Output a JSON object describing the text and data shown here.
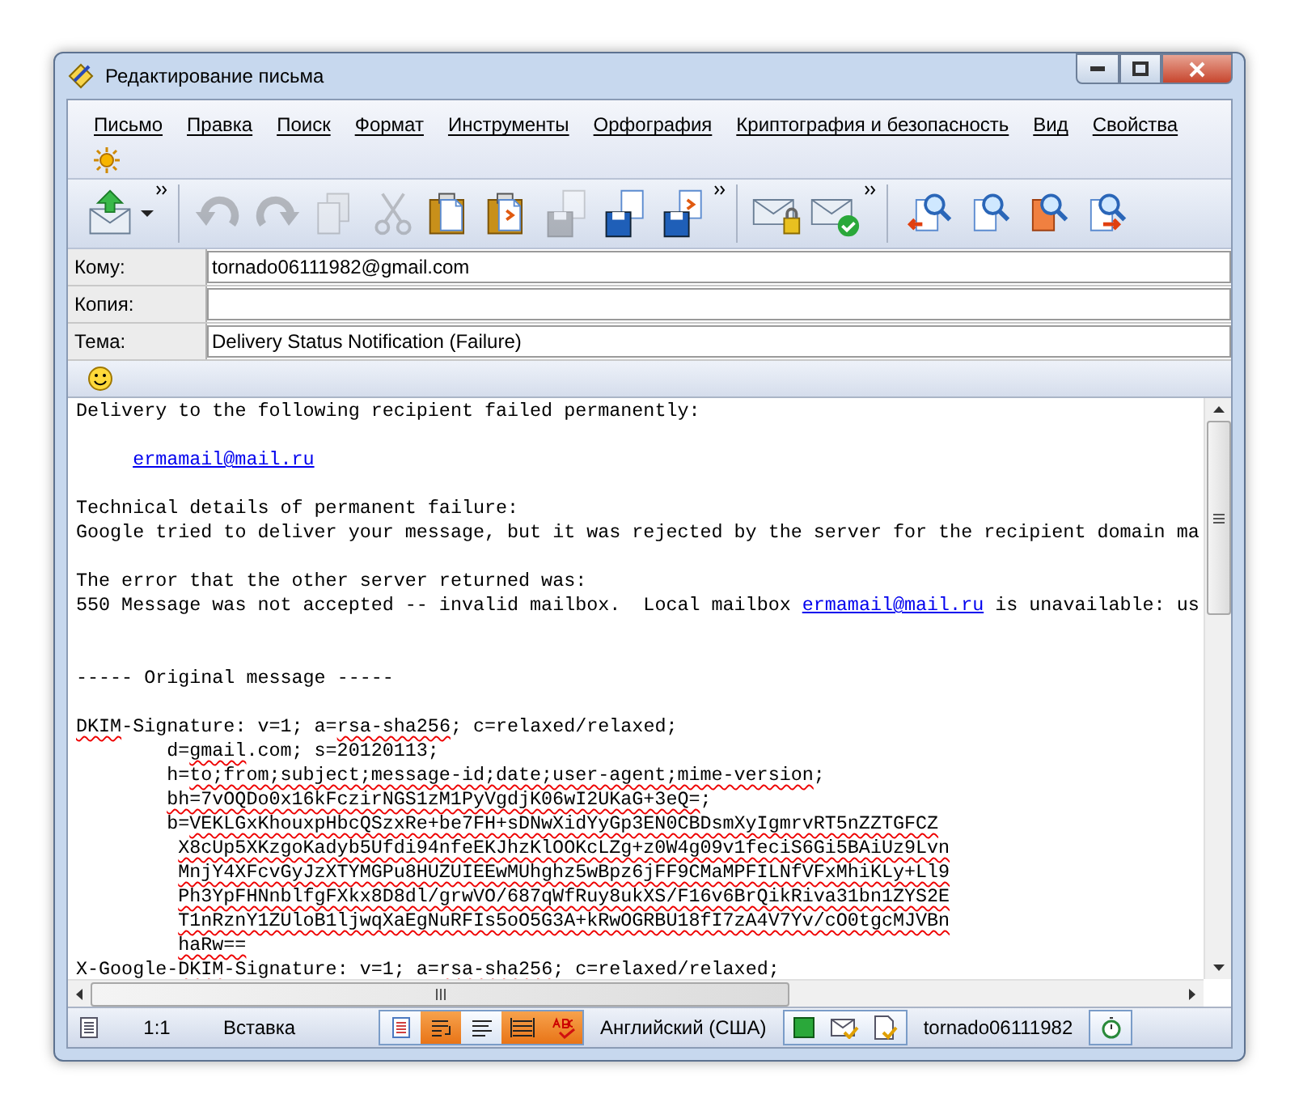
{
  "window": {
    "title": "Редактирование письма"
  },
  "menu": [
    {
      "label": "Письмо"
    },
    {
      "label": "Правка"
    },
    {
      "label": "Поиск"
    },
    {
      "label": "Формат"
    },
    {
      "label": "Инструменты"
    },
    {
      "label": "Орфография"
    },
    {
      "label": "Криптография и безопасность"
    },
    {
      "label": "Вид"
    },
    {
      "label": "Свойства"
    }
  ],
  "toolbar": [
    {
      "kind": "send",
      "disabled": false,
      "dropdown": true,
      "group_end": true
    },
    {
      "kind": "undo",
      "disabled": true
    },
    {
      "kind": "redo",
      "disabled": true
    },
    {
      "kind": "copy",
      "disabled": true
    },
    {
      "kind": "cut",
      "disabled": true
    },
    {
      "kind": "paste",
      "disabled": false
    },
    {
      "kind": "paste-special",
      "disabled": false
    },
    {
      "kind": "save",
      "disabled": true
    },
    {
      "kind": "save",
      "disabled": false
    },
    {
      "kind": "save-as",
      "disabled": false,
      "group_end": true
    },
    {
      "kind": "encrypt",
      "disabled": false
    },
    {
      "kind": "sign",
      "disabled": false,
      "group_end": true
    },
    {
      "kind": "find-back",
      "disabled": false
    },
    {
      "kind": "find",
      "disabled": false
    },
    {
      "kind": "find-red",
      "disabled": false
    },
    {
      "kind": "find-next",
      "disabled": false
    }
  ],
  "header_fields": [
    {
      "label": "Кому:",
      "value": "tornado06111982@gmail.com"
    },
    {
      "label": "Копия:"
    },
    {
      "label": "Тема:",
      "value": "Delivery Status Notification (Failure)"
    }
  ],
  "body_lines": [
    {
      "kind": "plain",
      "segments": [
        {
          "kind": "text",
          "text": "Delivery to the following recipient failed permanently:"
        }
      ]
    },
    {
      "kind": "blank"
    },
    {
      "kind": "indent5",
      "segments": [
        {
          "kind": "link",
          "text": "ermamail@mail.ru"
        }
      ]
    },
    {
      "kind": "blank"
    },
    {
      "kind": "plain",
      "segments": [
        {
          "kind": "text",
          "text": "Technical details of permanent failure:"
        }
      ]
    },
    {
      "kind": "plain",
      "segments": [
        {
          "kind": "text",
          "text": "Google tried to deliver your message, but it was rejected by the server for the recipient domain ma"
        }
      ]
    },
    {
      "kind": "blank"
    },
    {
      "kind": "plain",
      "segments": [
        {
          "kind": "text",
          "text": "The error that the other server returned was:"
        }
      ]
    },
    {
      "kind": "plain",
      "segments": [
        {
          "kind": "text",
          "text": "550 Message was not accepted -- invalid mailbox.  Local mailbox "
        },
        {
          "kind": "link",
          "text": "ermamail@mail.ru"
        },
        {
          "kind": "text",
          "text": " is unavailable: us"
        }
      ]
    },
    {
      "kind": "blank"
    },
    {
      "kind": "blank"
    },
    {
      "kind": "plain",
      "segments": [
        {
          "kind": "text",
          "text": "----- Original message -----"
        }
      ]
    },
    {
      "kind": "blank"
    },
    {
      "kind": "plain",
      "segments": [
        {
          "kind": "misspelled",
          "text": "DKIM"
        },
        {
          "kind": "text",
          "text": "-Signature: v=1; a="
        },
        {
          "kind": "misspelled",
          "text": "rsa-sha256"
        },
        {
          "kind": "text",
          "text": "; c=relaxed/relaxed;"
        }
      ]
    },
    {
      "kind": "indent8",
      "segments": [
        {
          "kind": "text",
          "text": "d="
        },
        {
          "kind": "misspelled",
          "text": "gmail"
        },
        {
          "kind": "text",
          "text": ".com; s=20120113;"
        }
      ]
    },
    {
      "kind": "indent8",
      "segments": [
        {
          "kind": "text",
          "text": "h="
        },
        {
          "kind": "misspelled",
          "text": "to;from;subject;message-id;date;user-agent;mime-version"
        },
        {
          "kind": "text",
          "text": ";"
        }
      ]
    },
    {
      "kind": "indent8",
      "segments": [
        {
          "kind": "misspelled",
          "text": "bh=7vOQDo0x16kFczirNGS1zM1PyVgdjK06wI2UKaG+3eQ="
        },
        {
          "kind": "text",
          "text": ";"
        }
      ]
    },
    {
      "kind": "indent8",
      "segments": [
        {
          "kind": "text",
          "text": "b="
        },
        {
          "kind": "misspelled",
          "text": "VEKLGxKhouxpHbcQSzxRe+be7FH+sDNwXidYyGp3EN0CBDsmXyIgmrvRT5nZZTGFCZ"
        }
      ]
    },
    {
      "kind": "indent9",
      "segments": [
        {
          "kind": "misspelled",
          "text": "X8cUp5XKzgoKadyb5Ufdi94nfeEKJhzKlOOKcLZg+z0W4g09v1feciS6Gi5BAiUz9Lvn"
        }
      ]
    },
    {
      "kind": "indent9",
      "segments": [
        {
          "kind": "misspelled",
          "text": "MnjY4XFcvGyJzXTYMGPu8HUZUIEEwMUhghz5wBpz6jFF9CMaMPFILNfVFxMhiKLy+Ll9"
        }
      ]
    },
    {
      "kind": "indent9",
      "segments": [
        {
          "kind": "misspelled",
          "text": "Ph3YpFHNnblfgFXkx8D8dl/grwVO/687qWfRuy8ukXS/F16v6BrQikRiva31bn1ZYS2E"
        }
      ]
    },
    {
      "kind": "indent9",
      "segments": [
        {
          "kind": "misspelled",
          "text": "T1nRznY1ZUloB1ljwqXaEgNuRFIs5oO5G3A+kRwOGRBU18fI7zA4V7Yv/cO0tgcMJVBn"
        }
      ]
    },
    {
      "kind": "indent9",
      "segments": [
        {
          "kind": "misspelled",
          "text": "haRw=="
        }
      ]
    },
    {
      "kind": "plain",
      "segments": [
        {
          "kind": "text",
          "text": "X-Google-"
        },
        {
          "kind": "misspelled",
          "text": "DKIM"
        },
        {
          "kind": "text",
          "text": "-Signature: v=1; a="
        },
        {
          "kind": "misspelled",
          "text": "rsa-sha256"
        },
        {
          "kind": "text",
          "text": "; c=relaxed/relaxed;"
        }
      ]
    }
  ],
  "status_bar": {
    "position": "1:1",
    "mode": "Вставка",
    "toggles": [
      {
        "kind": "page",
        "on": false
      },
      {
        "kind": "wrap",
        "on": true
      },
      {
        "kind": "lines",
        "on": false
      },
      {
        "kind": "justify",
        "on": true
      },
      {
        "kind": "spell",
        "on": true
      }
    ],
    "language": "Английский (США)",
    "tools": [
      {
        "kind": "green-square"
      },
      {
        "kind": "mail-check"
      },
      {
        "kind": "doc-check"
      }
    ],
    "account": "tornado06111982"
  }
}
